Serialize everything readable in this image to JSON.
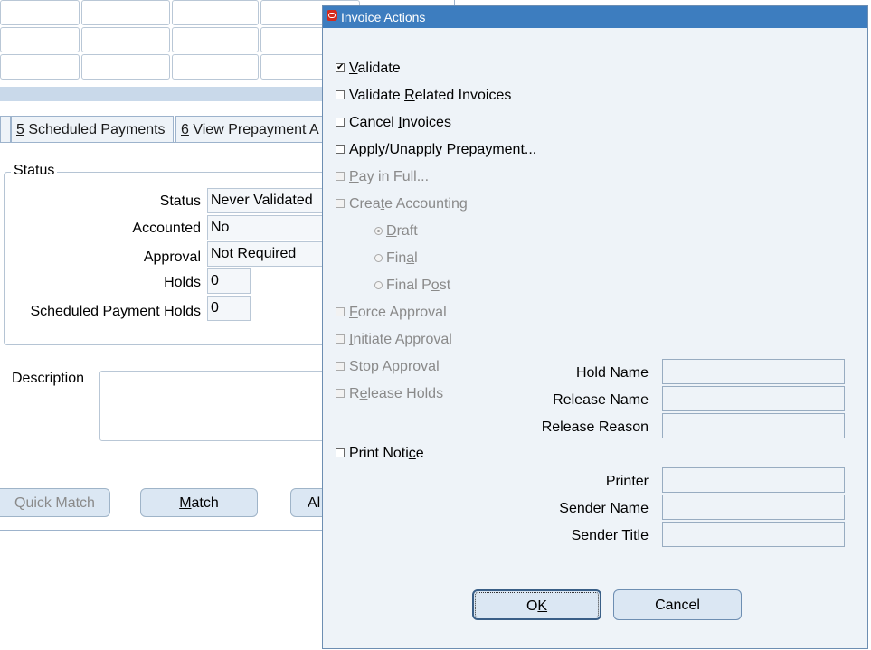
{
  "background": {
    "tabs": [
      {
        "num": "5",
        "label": " Scheduled Payments"
      },
      {
        "num": "6",
        "label": " View Prepayment A"
      }
    ],
    "status_group_title": "Status",
    "status_rows": [
      {
        "label": "Status",
        "value": "Never Validated"
      },
      {
        "label": "Accounted",
        "value": "No"
      },
      {
        "label": "Approval",
        "value": "Not Required"
      },
      {
        "label": "Holds",
        "value": "0"
      },
      {
        "label": "Scheduled Payment Holds",
        "value": "0"
      }
    ],
    "description_label": "Description",
    "buttons": {
      "quick_match": "Quick Match",
      "match": "Match",
      "all": "Al"
    }
  },
  "dialog": {
    "title": "Invoice Actions",
    "options": [
      {
        "id": "validate",
        "pre": "",
        "key": "V",
        "post": "alidate",
        "checked": true,
        "disabled": false
      },
      {
        "id": "validate-related",
        "pre": "Validate ",
        "key": "R",
        "post": "elated Invoices",
        "checked": false,
        "disabled": false
      },
      {
        "id": "cancel-invoices",
        "pre": "Cancel ",
        "key": "I",
        "post": "nvoices",
        "checked": false,
        "disabled": false
      },
      {
        "id": "apply-unapply",
        "pre": "Apply/",
        "key": "U",
        "post": "napply Prepayment...",
        "checked": false,
        "disabled": false
      },
      {
        "id": "pay-in-full",
        "pre": "",
        "key": "P",
        "post": "ay in Full...",
        "checked": false,
        "disabled": true
      },
      {
        "id": "create-accounting",
        "pre": "Crea",
        "key": "t",
        "post": "e Accounting",
        "checked": false,
        "disabled": true
      },
      {
        "id": "force-approval",
        "pre": "",
        "key": "F",
        "post": "orce Approval",
        "checked": false,
        "disabled": true
      },
      {
        "id": "initiate-approval",
        "pre": "",
        "key": "I",
        "post": "nitiate Approval",
        "checked": false,
        "disabled": true
      },
      {
        "id": "stop-approval",
        "pre": "",
        "key": "S",
        "post": "top Approval",
        "checked": false,
        "disabled": true
      },
      {
        "id": "release-holds",
        "pre": "R",
        "key": "e",
        "post": "lease Holds",
        "checked": false,
        "disabled": true
      },
      {
        "id": "print-notice",
        "pre": "Print Noti",
        "key": "c",
        "post": "e",
        "checked": false,
        "disabled": false
      }
    ],
    "radios": [
      {
        "id": "draft",
        "pre": "",
        "key": "D",
        "post": "raft",
        "selected": true
      },
      {
        "id": "final",
        "pre": "Fin",
        "key": "a",
        "post": "l",
        "selected": false
      },
      {
        "id": "final-post",
        "pre": "Final P",
        "key": "o",
        "post": "st",
        "selected": false
      }
    ],
    "fields": {
      "hold_name": "Hold Name",
      "release_name": "Release Name",
      "release_reason": "Release Reason",
      "printer": "Printer",
      "sender_name": "Sender Name",
      "sender_title": "Sender Title"
    },
    "ok": {
      "pre": "O",
      "key": "K",
      "post": ""
    },
    "cancel": {
      "pre": "Cancel",
      "key": "",
      "post": ""
    }
  }
}
